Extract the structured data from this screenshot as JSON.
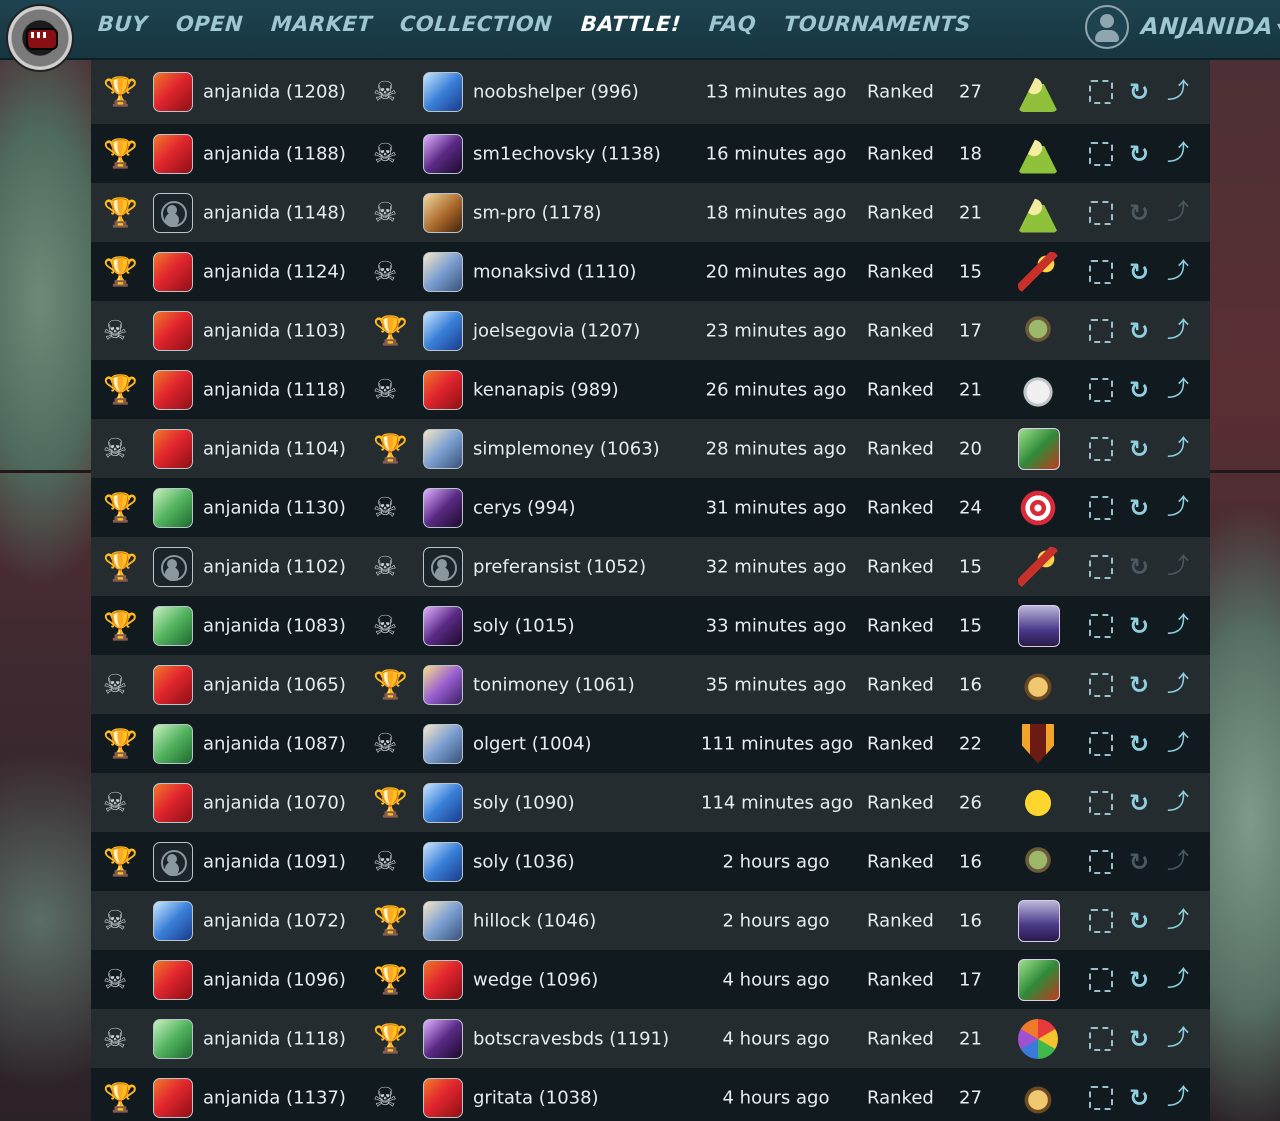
{
  "header": {
    "nav": [
      "BUY",
      "OPEN",
      "MARKET",
      "COLLECTION",
      "BATTLE!",
      "FAQ",
      "TOURNAMENTS"
    ],
    "active": "BATTLE!",
    "username": "ANJANIDA"
  },
  "icons": {
    "win": "trophy-icon",
    "loss": "skull-icon",
    "view": "battle-view-icon",
    "rematch": "refresh-icon",
    "share": "share-icon"
  },
  "rows": [
    {
      "p1_result": "win",
      "p1_avatar": "fire",
      "p1_name": "anjanida (1208)",
      "p2_result": "loss",
      "p2_avatar": "water",
      "p2_name": "noobshelper (996)",
      "time": "13 minutes ago",
      "type": "Ranked",
      "mana": "27",
      "rule": "sun",
      "actions_enabled": true
    },
    {
      "p1_result": "win",
      "p1_avatar": "fire",
      "p1_name": "anjanida (1188)",
      "p2_result": "loss",
      "p2_avatar": "death",
      "p2_name": "sm1echovsky (1138)",
      "time": "16 minutes ago",
      "type": "Ranked",
      "mana": "18",
      "rule": "sun",
      "actions_enabled": true
    },
    {
      "p1_result": "win",
      "p1_avatar": "default",
      "p1_name": "anjanida (1148)",
      "p2_result": "loss",
      "p2_avatar": "earth",
      "p2_name": "sm-pro (1178)",
      "time": "18 minutes ago",
      "type": "Ranked",
      "mana": "21",
      "rule": "sun",
      "actions_enabled": false
    },
    {
      "p1_result": "win",
      "p1_avatar": "fire",
      "p1_name": "anjanida (1124)",
      "p2_result": "loss",
      "p2_avatar": "knight",
      "p2_name": "monaksivd (1110)",
      "time": "20 minutes ago",
      "type": "Ranked",
      "mana": "15",
      "rule": "fire",
      "actions_enabled": true
    },
    {
      "p1_result": "loss",
      "p1_avatar": "fire",
      "p1_name": "anjanida (1103)",
      "p2_result": "win",
      "p2_avatar": "water",
      "p2_name": "joelsegovia (1207)",
      "time": "23 minutes ago",
      "type": "Ranked",
      "mana": "17",
      "rule": "goblin",
      "actions_enabled": true
    },
    {
      "p1_result": "win",
      "p1_avatar": "fire",
      "p1_name": "anjanida (1118)",
      "p2_result": "loss",
      "p2_avatar": "fire",
      "p2_name": "kenanapis (989)",
      "time": "26 minutes ago",
      "type": "Ranked",
      "mana": "21",
      "rule": "cloud",
      "actions_enabled": true
    },
    {
      "p1_result": "loss",
      "p1_avatar": "fire",
      "p1_name": "anjanida (1104)",
      "p2_result": "win",
      "p2_avatar": "knight",
      "p2_name": "simplemoney (1063)",
      "time": "28 minutes ago",
      "type": "Ranked",
      "mana": "20",
      "rule": "green",
      "actions_enabled": true
    },
    {
      "p1_result": "win",
      "p1_avatar": "life",
      "p1_name": "anjanida (1130)",
      "p2_result": "loss",
      "p2_avatar": "death",
      "p2_name": "cerys (994)",
      "time": "31 minutes ago",
      "type": "Ranked",
      "mana": "24",
      "rule": "target",
      "actions_enabled": true
    },
    {
      "p1_result": "win",
      "p1_avatar": "default",
      "p1_name": "anjanida (1102)",
      "p2_result": "loss",
      "p2_avatar": "default",
      "p2_name": "preferansist (1052)",
      "time": "32 minutes ago",
      "type": "Ranked",
      "mana": "15",
      "rule": "fire",
      "actions_enabled": false
    },
    {
      "p1_result": "win",
      "p1_avatar": "life",
      "p1_name": "anjanida (1083)",
      "p2_result": "loss",
      "p2_avatar": "death",
      "p2_name": "soly (1015)",
      "time": "33 minutes ago",
      "type": "Ranked",
      "mana": "15",
      "rule": "hood",
      "actions_enabled": true
    },
    {
      "p1_result": "loss",
      "p1_avatar": "fire",
      "p1_name": "anjanida (1065)",
      "p2_result": "win",
      "p2_avatar": "dragon",
      "p2_name": "tonimoney (1061)",
      "time": "35 minutes ago",
      "type": "Ranked",
      "mana": "16",
      "rule": "bow",
      "actions_enabled": true
    },
    {
      "p1_result": "win",
      "p1_avatar": "life",
      "p1_name": "anjanida (1087)",
      "p2_result": "loss",
      "p2_avatar": "knight",
      "p2_name": "olgert (1004)",
      "time": "111 minutes ago",
      "type": "Ranked",
      "mana": "22",
      "rule": "shield",
      "actions_enabled": true
    },
    {
      "p1_result": "loss",
      "p1_avatar": "fire",
      "p1_name": "anjanida (1070)",
      "p2_result": "win",
      "p2_avatar": "water",
      "p2_name": "soly (1090)",
      "time": "114 minutes ago",
      "type": "Ranked",
      "mana": "26",
      "rule": "bird",
      "actions_enabled": true
    },
    {
      "p1_result": "win",
      "p1_avatar": "default",
      "p1_name": "anjanida (1091)",
      "p2_result": "loss",
      "p2_avatar": "water",
      "p2_name": "soly (1036)",
      "time": "2 hours ago",
      "type": "Ranked",
      "mana": "16",
      "rule": "goblin",
      "actions_enabled": false
    },
    {
      "p1_result": "loss",
      "p1_avatar": "water",
      "p1_name": "anjanida (1072)",
      "p2_result": "win",
      "p2_avatar": "knight",
      "p2_name": "hillock (1046)",
      "time": "2 hours ago",
      "type": "Ranked",
      "mana": "16",
      "rule": "hood",
      "actions_enabled": true
    },
    {
      "p1_result": "loss",
      "p1_avatar": "fire",
      "p1_name": "anjanida (1096)",
      "p2_result": "win",
      "p2_avatar": "fire",
      "p2_name": "wedge (1096)",
      "time": "4 hours ago",
      "type": "Ranked",
      "mana": "17",
      "rule": "green",
      "actions_enabled": true
    },
    {
      "p1_result": "loss",
      "p1_avatar": "life",
      "p1_name": "anjanida (1118)",
      "p2_result": "win",
      "p2_avatar": "death",
      "p2_name": "botscravesbds (1191)",
      "time": "4 hours ago",
      "type": "Ranked",
      "mana": "21",
      "rule": "wheel",
      "actions_enabled": true
    },
    {
      "p1_result": "win",
      "p1_avatar": "fire",
      "p1_name": "anjanida (1137)",
      "p2_result": "loss",
      "p2_avatar": "fire",
      "p2_name": "gritata (1038)",
      "time": "4 hours ago",
      "type": "Ranked",
      "mana": "27",
      "rule": "bow",
      "actions_enabled": true
    }
  ]
}
